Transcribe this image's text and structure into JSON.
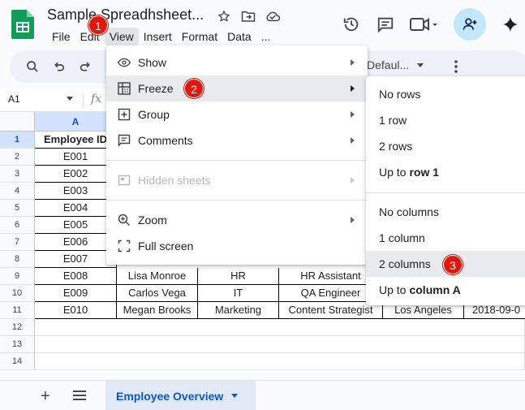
{
  "app": {
    "title": "Sample Spreadhsheet...",
    "menus": [
      "File",
      "Edit",
      "View",
      "Insert",
      "Format",
      "Data",
      "..."
    ]
  },
  "toolbar": {
    "font": "Defaul..."
  },
  "formula_bar": {
    "cell_ref": "A1",
    "fx": "fx"
  },
  "columns": [
    "A"
  ],
  "rows": [
    "1",
    "2",
    "3",
    "4",
    "5",
    "6",
    "7",
    "8",
    "9",
    "10",
    "11",
    "12",
    "13",
    "14"
  ],
  "table": {
    "header": "Employee ID",
    "ids": [
      "E001",
      "E002",
      "E003",
      "E004",
      "E005",
      "E006",
      "E007",
      "E008",
      "E009",
      "E010"
    ],
    "partial_rows": [
      [
        "E008",
        "Lisa Monroe",
        "HR",
        "HR Assistant",
        "",
        ""
      ],
      [
        "E009",
        "Carlos Vega",
        "IT",
        "QA Engineer",
        "",
        ""
      ],
      [
        "E010",
        "Megan Brooks",
        "Marketing",
        "Content Strategist",
        "Los Angeles",
        "2018-09-0"
      ]
    ]
  },
  "view_menu": {
    "items": [
      {
        "label": "Show",
        "icon": "eye-icon"
      },
      {
        "label": "Freeze",
        "icon": "freeze-grid-icon"
      },
      {
        "label": "Group",
        "icon": "group-plus-icon"
      },
      {
        "label": "Comments",
        "icon": "comment-icon"
      },
      {
        "label": "Hidden sheets",
        "icon": "hidden-sheet-icon"
      },
      {
        "label": "Zoom",
        "icon": "zoom-icon"
      },
      {
        "label": "Full screen",
        "icon": "fullscreen-icon"
      }
    ]
  },
  "freeze_submenu": {
    "no_rows": "No rows",
    "one_row": "1 row",
    "two_rows": "2 rows",
    "up_to_row_prefix": "Up to",
    "up_to_row_bold": "row 1",
    "no_columns": "No columns",
    "one_column": "1 column",
    "two_columns": "2 columns",
    "up_to_col_prefix": "Up to",
    "up_to_col_bold": "column A"
  },
  "steps": [
    "1",
    "2",
    "3"
  ],
  "sheet_tab": {
    "label": "Employee Overview"
  },
  "colors": {
    "accent": "#0b57d0",
    "badge": "#e0170d",
    "share": "#c2e7ff"
  }
}
